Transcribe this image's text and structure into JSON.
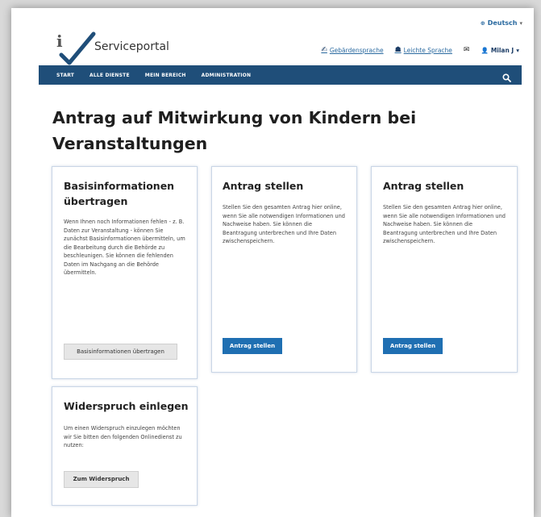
{
  "header": {
    "language": "Deutsch",
    "brand": "Serviceportal",
    "links": {
      "sign_language": "Gebärdensprache",
      "easy_language": "Leichte Sprache"
    },
    "user": "Milan J"
  },
  "nav": {
    "items": [
      "START",
      "ALLE DIENSTE",
      "MEIN BEREICH",
      "ADMINISTRATION"
    ]
  },
  "page": {
    "title": "Antrag auf Mitwirkung von Kindern bei Veranstaltungen"
  },
  "cards": {
    "basis": {
      "title": "Basisinformationen übertragen",
      "text": "Wenn Ihnen noch Informationen fehlen - z. B. Daten zur Veranstaltung - können Sie zunächst Basisinformationen übermitteln, um die Bearbeitung durch die Behörde zu beschleunigen. Sie können die fehlenden Daten im Nachgang an die Behörde übermitteln.",
      "button": "Basisinformationen übertragen"
    },
    "antrag1": {
      "title": "Antrag stellen",
      "text": "Stellen Sie den gesamten Antrag hier online, wenn Sie alle notwendigen Informationen und Nachweise haben. Sie können die Beantragung unterbrechen und Ihre Daten zwischenspeichern.",
      "button": "Antrag stellen"
    },
    "antrag2": {
      "title": "Antrag stellen",
      "text": "Stellen Sie den gesamten Antrag hier online, wenn Sie alle notwendigen Informationen und Nachweise haben. Sie können die Beantragung unterbrechen und Ihre Daten zwischenspeichern.",
      "button": "Antrag stellen"
    },
    "widerspruch": {
      "title": "Widerspruch einlegen",
      "text": "Um einen Widerspruch einzulegen möchten wir Sie bitten den folgenden Onlinedienst zu nutzen:",
      "button": "Zum Widerspruch"
    }
  },
  "colors": {
    "navbar": "#1f4e79",
    "primary_button": "#1f6fb2",
    "link": "#2a6aa0"
  },
  "icons": [
    "globe-icon",
    "logo-icon",
    "sign-language-icon",
    "easy-language-icon",
    "mail-icon",
    "user-icon",
    "search-icon"
  ]
}
